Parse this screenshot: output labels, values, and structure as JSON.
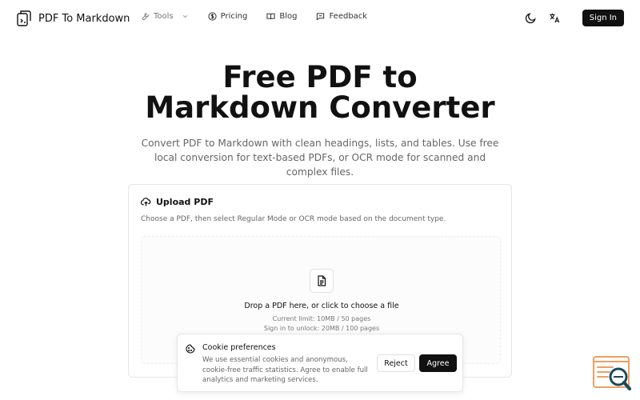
{
  "nav": {
    "brand": "PDF To Markdown",
    "links": [
      {
        "label": "Tools",
        "icon": "wrench-icon"
      },
      {
        "label": "Pricing",
        "icon": "dollar-circle-icon"
      },
      {
        "label": "Blog",
        "icon": "book-icon"
      },
      {
        "label": "Feedback",
        "icon": "message-icon"
      }
    ],
    "sign_in": "Sign In"
  },
  "hero": {
    "title_line1": "Free PDF to",
    "title_line2": "Markdown Converter",
    "subtitle": "Convert PDF to Markdown with clean headings, lists, and tables. Use free local conversion for text-based PDFs, or OCR mode for scanned and complex files."
  },
  "upload": {
    "title": "Upload PDF",
    "description": "Choose a PDF, then select Regular Mode or OCR mode based on the document type.",
    "drop_text": "Drop a PDF here, or click to choose a file",
    "limit": "Current limit: 10MB / 50 pages",
    "unlock": "Sign in to unlock: 20MB / 100 pages"
  },
  "cookie": {
    "title": "Cookie preferences",
    "body": "We use essential cookies and anonymous, cookie-free traffic statistics. Agree to enable full analytics and marketing services.",
    "reject": "Reject",
    "agree": "Agree"
  },
  "colors": {
    "primary": "#111111",
    "muted": "#666666",
    "widget_accent": "#f0a060",
    "widget_dark": "#1a4a5a"
  }
}
